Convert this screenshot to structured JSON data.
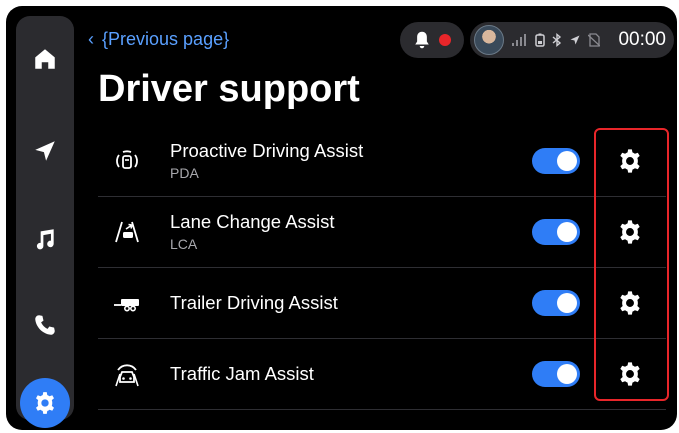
{
  "sidebar": {
    "items": [
      {
        "name": "home",
        "icon": "home-icon",
        "active": false
      },
      {
        "name": "navigation",
        "icon": "navigation-arrow-icon",
        "active": false
      },
      {
        "name": "music",
        "icon": "music-note-icon",
        "active": false
      },
      {
        "name": "phone",
        "icon": "phone-icon",
        "active": false
      },
      {
        "name": "settings",
        "icon": "gear-icon",
        "active": true
      }
    ]
  },
  "header": {
    "back_label": "{Previous page}",
    "clock": "00:00",
    "status_icons": [
      "signal-icon",
      "battery-icon",
      "bluetooth-icon",
      "location-icon",
      "no-sim-icon"
    ]
  },
  "page": {
    "title": "Driver support"
  },
  "settings": [
    {
      "title": "Proactive Driving Assist",
      "subtitle": "PDA",
      "icon": "pda-icon",
      "enabled": true
    },
    {
      "title": "Lane Change Assist",
      "subtitle": "LCA",
      "icon": "lane-change-icon",
      "enabled": true
    },
    {
      "title": "Trailer Driving Assist",
      "subtitle": "",
      "icon": "trailer-icon",
      "enabled": true
    },
    {
      "title": "Traffic Jam Assist",
      "subtitle": "",
      "icon": "traffic-jam-icon",
      "enabled": true
    }
  ],
  "colors": {
    "accent": "#2f7df6",
    "highlight": "#e8262a",
    "background": "#000000",
    "panel": "#2b2b2f",
    "link": "#5aa0ff"
  }
}
